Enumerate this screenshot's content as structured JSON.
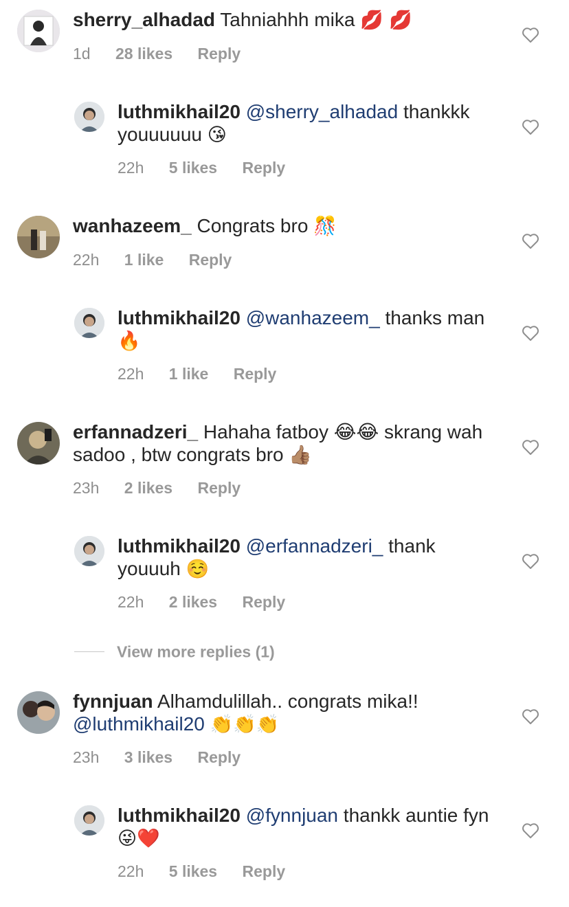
{
  "comments": [
    {
      "username": "sherry_alhadad",
      "mention": "",
      "text": "Tahniahhh mika",
      "emoji": "💋 💋",
      "time": "1d",
      "likes": "28 likes",
      "reply": "Reply"
    },
    {
      "username": "luthmikhail20",
      "mention": "@sherry_alhadad",
      "text": "thankkk youuuuuu",
      "emoji": "😘",
      "time": "22h",
      "likes": "5 likes",
      "reply": "Reply"
    },
    {
      "username": "wanhazeem_",
      "mention": "",
      "text": "Congrats bro",
      "emoji": "🎊",
      "time": "22h",
      "likes": "1 like",
      "reply": "Reply"
    },
    {
      "username": "luthmikhail20",
      "mention": "@wanhazeem_",
      "text": "thanks man",
      "emoji": "🔥",
      "time": "22h",
      "likes": "1 like",
      "reply": "Reply"
    },
    {
      "username": "erfannadzeri_",
      "mention": "",
      "text": "Hahaha fatboy 😂😂 skrang wah sadoo , btw congrats bro",
      "emoji": "👍🏽",
      "time": "23h",
      "likes": "2 likes",
      "reply": "Reply"
    },
    {
      "username": "luthmikhail20",
      "mention": "@erfannadzeri_",
      "text": "thank youuuh",
      "emoji": "☺️",
      "time": "22h",
      "likes": "2 likes",
      "reply": "Reply"
    },
    {
      "username": "fynnjuan",
      "mention": "",
      "text": "Alhamdulillah.. congrats mika!!",
      "mention2": "@luthmikhail20",
      "emoji": "👏👏👏",
      "time": "23h",
      "likes": "3 likes",
      "reply": "Reply"
    },
    {
      "username": "luthmikhail20",
      "mention": "@fynnjuan",
      "text": "thankk auntie fyn",
      "emoji": "😜❤️",
      "time": "22h",
      "likes": "5 likes",
      "reply": "Reply"
    }
  ],
  "view_more": "View more replies (1)"
}
